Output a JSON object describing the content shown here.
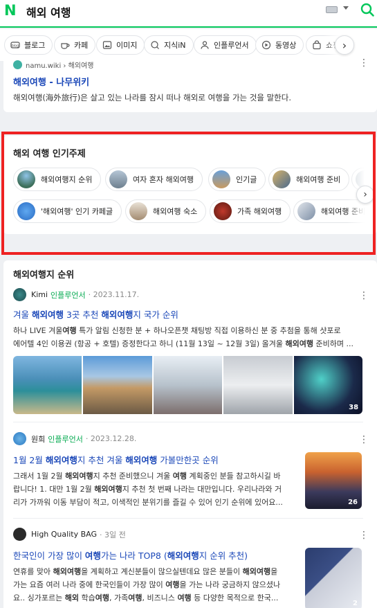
{
  "header": {
    "logo": "N",
    "query": "해외 여행",
    "colors": {
      "brand": "#03c75a",
      "link": "#1a47b8",
      "influencer": "#03a94f",
      "highlight_box": "#ee2222"
    }
  },
  "tabs": [
    {
      "label": "블로그",
      "icon": "blog-icon"
    },
    {
      "label": "카페",
      "icon": "cafe-icon"
    },
    {
      "label": "이미지",
      "icon": "image-icon"
    },
    {
      "label": "지식iN",
      "icon": "qna-icon"
    },
    {
      "label": "인플루언서",
      "icon": "person-icon"
    },
    {
      "label": "동영상",
      "icon": "play-icon"
    },
    {
      "label": "쇼핑",
      "icon": "shopping-bag-icon"
    }
  ],
  "wiki": {
    "source": "namu.wiki › 해외여행",
    "title": "해외여행 - 나무위키",
    "description": "해외여행(海外旅行)은 살고 있는 나라를 잠시 떠나 해외로 여행을 가는 것을 말한다."
  },
  "popular": {
    "title": "해외 여행 인기주제",
    "row1": [
      "해외여행지 순위",
      "여자 혼자 해외여행",
      "인기글",
      "해외여행 준비"
    ],
    "row2": [
      "'해외여행' 인기 카페글",
      "해외여행 숙소",
      "가족 해외여행",
      "해외여행 준비"
    ]
  },
  "results": {
    "title": "해외여행지 순위",
    "items": [
      {
        "author": "Kimi",
        "badge": "인플루언서",
        "date": "· 2023.11.17.",
        "title_parts": [
          "겨울 ",
          "해외여행",
          " 3곳 추천 ",
          "해외여행",
          "지 국가 순위"
        ],
        "desc_line1_parts": [
          "하나 LIVE 겨울",
          "여행",
          " 특가 알림 신청한 분 + 하나오픈챗 채팅방 직접 이용하신 분 중 추첨을 통해 샷포로"
        ],
        "desc_line2_parts": [
          "에어텔 4인 이용권 (항공 + 호텔) 증정한다고 하니 (11월 13일 ~ 12월 3일) 올겨울 ",
          "해외여행",
          " 준비하며 ..."
        ],
        "image_count": "38"
      },
      {
        "author": "원희",
        "badge": "인플루언서",
        "date": "· 2023.12.28.",
        "title_parts": [
          "1월 2월 ",
          "해외여행",
          "지 추천 겨울 ",
          "해외여행",
          " 가볼만한곳 순위"
        ],
        "desc_lines": [
          [
            "그래서 1월 2월 ",
            "해외여행",
            "지 추천 준비했으니 겨울 ",
            "여행",
            " 계획중인 분들 참고하시길 바"
          ],
          [
            "랍니다! 1. 대만 1월 2월 ",
            "해외여행",
            "지 추천 첫 번째 나라는 대만입니다. 우리나라와 거"
          ],
          [
            "리가 가까워 이동 부담이 적고, 이색적인 분위기를 즐길 수 있어 인기 순위에 있어요..."
          ]
        ],
        "image_count": "26"
      },
      {
        "author": "High Quality BAG",
        "badge": "",
        "date": "· 3일 전",
        "title_parts": [
          "한국인이 가장 많이 ",
          "여행",
          "가는 나라 TOP8 (",
          "해외여행",
          "지 순위 추천)"
        ],
        "desc_lines": [
          [
            "연휴를 맞아 ",
            "해외여행",
            "을 계획하고 계신분들이 많으실텐데요 많은 분들이 ",
            "해외여행",
            "을"
          ],
          [
            "가는 요즘 여러 나라 중에 한국인들이 가장 많이 ",
            "여행",
            "을 가는 나라 궁금하지 않으셨나"
          ],
          [
            "요.. 싱가포르는 ",
            "해외",
            " 학습",
            "여행",
            ", 가족",
            "여행",
            ", 비즈니스 ",
            "여행",
            " 등 다양한 목적으로 한국..."
          ]
        ],
        "image_count": "2"
      }
    ]
  }
}
